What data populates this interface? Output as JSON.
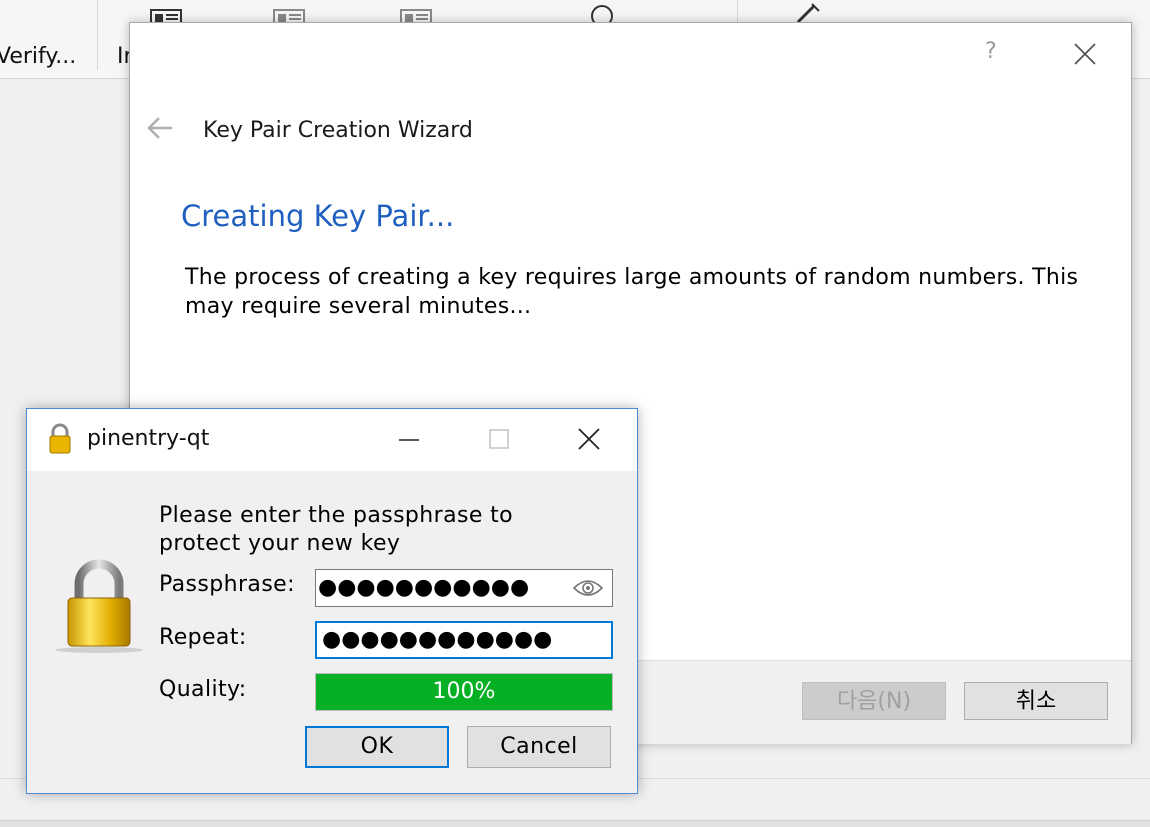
{
  "background_app": {
    "toolbar_labels": [
      "Verify...",
      "In"
    ]
  },
  "wizard": {
    "help_label": "?",
    "title": "Key Pair Creation Wizard",
    "heading": "Creating Key Pair...",
    "description": "The process of creating a key requires large amounts of random numbers. This may require several minutes...",
    "next_button": "다음(N)",
    "cancel_button": "취소",
    "next_enabled": false
  },
  "pinentry": {
    "window_title": "pinentry-qt",
    "description": "Please enter the passphrase to protect your new key",
    "passphrase_label": "Passphrase:",
    "passphrase_masked": "●●●●●●●●●●●",
    "repeat_label": "Repeat:",
    "repeat_masked": "●●●●●●●●●●●●",
    "quality_label": "Quality:",
    "quality_text": "100%",
    "quality_level": 1.0,
    "ok_button": "OK",
    "cancel_button": "Cancel",
    "colors": {
      "quality_fill": "#06b025",
      "accent": "#0078d7",
      "heading": "#1f5fbf"
    },
    "icons": [
      "lock-icon",
      "minimize-icon",
      "maximize-icon",
      "close-icon",
      "eye-icon",
      "padlock-icon"
    ]
  }
}
